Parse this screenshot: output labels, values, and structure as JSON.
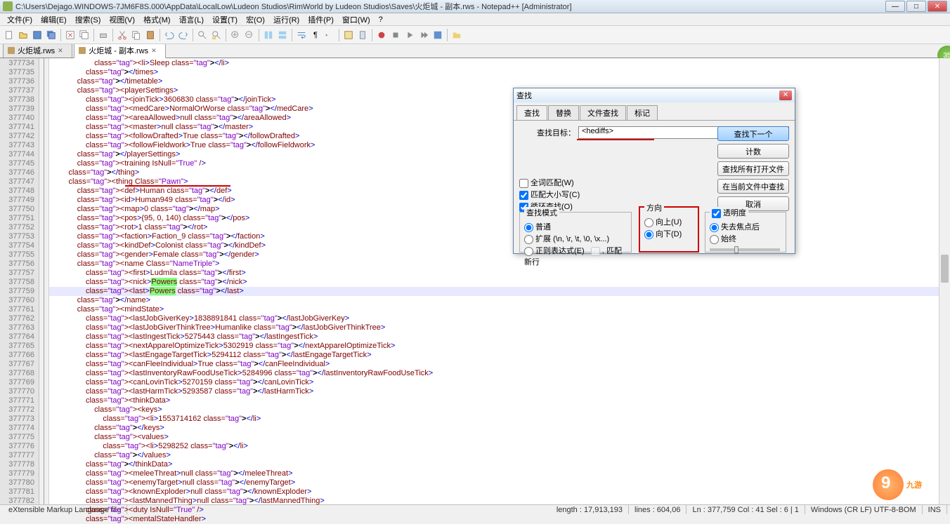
{
  "titlebar": {
    "path": "C:\\Users\\Dejago.WINDOWS-7JM6F8S.000\\AppData\\LocalLow\\Ludeon Studios\\RimWorld by Ludeon Studios\\Saves\\火炬城 - 副本.rws - Notepad++ [Administrator]"
  },
  "menu": [
    "文件(F)",
    "编辑(E)",
    "搜索(S)",
    "视图(V)",
    "格式(M)",
    "语言(L)",
    "设置(T)",
    "宏(O)",
    "运行(R)",
    "插件(P)",
    "窗口(W)",
    "?"
  ],
  "tabs": [
    {
      "label": "火炬城.rws",
      "active": false
    },
    {
      "label": "火炬城 - 副本.rws",
      "active": true
    }
  ],
  "badge": "35",
  "line_start": 377734,
  "line_count": 50,
  "highlight_line": 377759,
  "code": [
    "                    <li>Sleep</li>",
    "                </times>",
    "            </timetable>",
    "            <playerSettings>",
    "                <joinTick>3606830</joinTick>",
    "                <medCare>NormalOrWorse</medCare>",
    "                <areaAllowed>null</areaAllowed>",
    "                <master>null</master>",
    "                <followDrafted>True</followDrafted>",
    "                <followFieldwork>True</followFieldwork>",
    "            </playerSettings>",
    "            <training IsNull=\"True\" />",
    "        </thing>",
    "        <thing Class=\"Pawn\">",
    "            <def>Human</def>",
    "            <id>Human949</id>",
    "            <map>0</map>",
    "            <pos>(95, 0, 140)</pos>",
    "            <rot>1</rot>",
    "            <faction>Faction_9</faction>",
    "            <kindDef>Colonist</kindDef>",
    "            <gender>Female</gender>",
    "            <name Class=\"NameTriple\">",
    "                <first>Ludmila</first>",
    "                <nick>Powers</nick>",
    "                <last>Powers</last>",
    "            </name>",
    "            <mindState>",
    "                <lastJobGiverKey>1838891841</lastJobGiverKey>",
    "                <lastJobGiverThinkTree>Humanlike</lastJobGiverThinkTree>",
    "                <lastIngestTick>5275443</lastIngestTick>",
    "                <nextApparelOptimizeTick>5302919</nextApparelOptimizeTick>",
    "                <lastEngageTargetTick>5294112</lastEngageTargetTick>",
    "                <canFleeIndividual>True</canFleeIndividual>",
    "                <lastInventoryRawFoodUseTick>5284996</lastInventoryRawFoodUseTick>",
    "                <canLovinTick>5270159</canLovinTick>",
    "                <lastHarmTick>5293587</lastHarmTick>",
    "                <thinkData>",
    "                    <keys>",
    "                        <li>1553714162</li>",
    "                    </keys>",
    "                    <values>",
    "                        <li>5298252</li>",
    "                    </values>",
    "                </thinkData>",
    "                <meleeThreat>null</meleeThreat>",
    "                <enemyTarget>null</enemyTarget>",
    "                <knownExploder>null</knownExploder>",
    "                <lastMannedThing>null</lastMannedThing>",
    "                <duty IsNull=\"True\" />",
    "                <mentalStateHandler>"
  ],
  "find": {
    "title": "查找",
    "tabs": [
      "查找",
      "替换",
      "文件查找",
      "标记"
    ],
    "target_label": "查找目标：",
    "target_value": "<hediffs>",
    "btn_next": "查找下一个",
    "btn_count": "计数",
    "btn_all": "查找所有打开文件",
    "btn_current": "在当前文件中查找",
    "btn_cancel": "取消",
    "chk_word": "全词匹配(W)",
    "chk_case": "匹配大小写(C)",
    "chk_loop": "循环查找(O)",
    "grp_mode": "查找模式",
    "mode_normal": "普通",
    "mode_ext": "扩展 (\\n, \\r, \\t, \\0, \\x...)",
    "mode_regex": "正则表达式(E)",
    "mode_newline": ". 匹配新行",
    "grp_dir": "方向",
    "dir_up": "向上(U)",
    "dir_down": "向下(D)",
    "grp_trans": "透明度",
    "trans_lose": "失去焦点后",
    "trans_always": "始终"
  },
  "status": {
    "left": "eXtensible Markup Language file",
    "length": "length : 17,913,193",
    "lines": "lines : 604,06",
    "pos": "Ln : 377,759    Col : 41    Sel : 6 | 1",
    "enc": "Windows (CR LF)   UTF-8-BOM",
    "ins": "INS"
  },
  "watermark": "九游"
}
